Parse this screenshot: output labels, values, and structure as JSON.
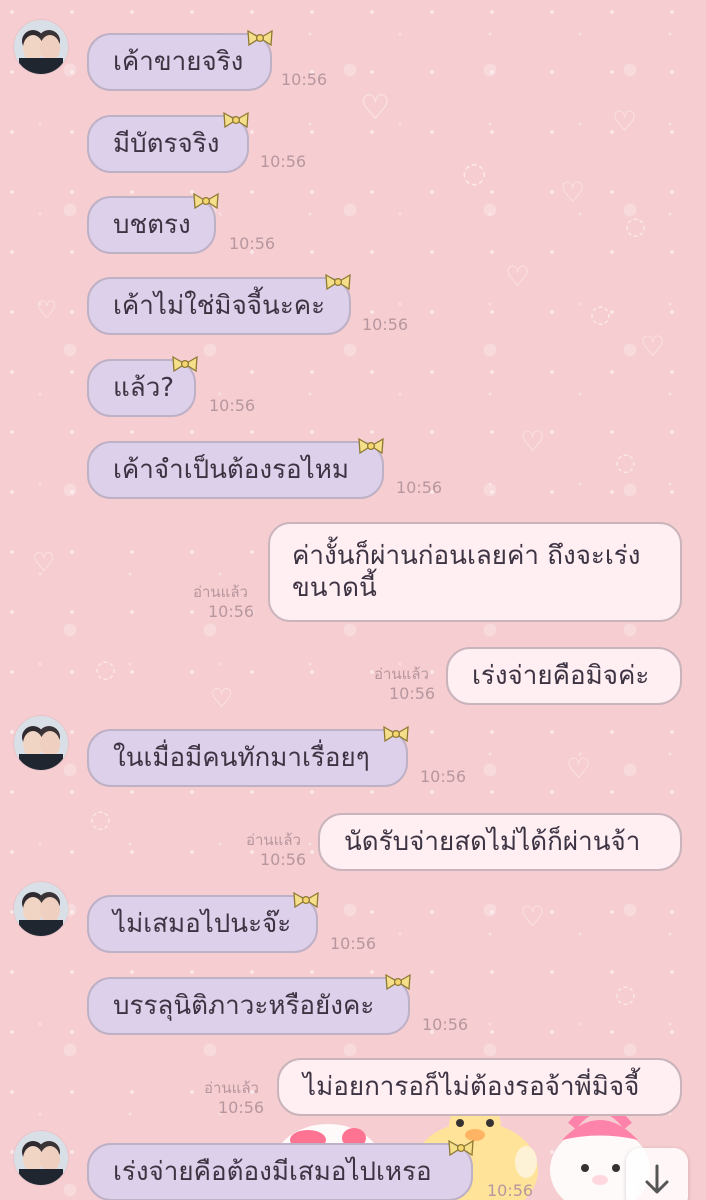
{
  "chat": {
    "incoming": [
      {
        "text": "เค้าขายจริง",
        "time": "10:56"
      },
      {
        "text": "มีบัตรจริง",
        "time": "10:56"
      },
      {
        "text": "บชตรง",
        "time": "10:56"
      },
      {
        "text": "เค้าไม่ใช่มิจจี้นะคะ",
        "time": "10:56"
      },
      {
        "text": "แล้ว?",
        "time": "10:56"
      },
      {
        "text": "เค้าจำเป็นต้องรอไหม",
        "time": "10:56"
      },
      {
        "text": "ในเมื่อมีคนทักมาเรื่อยๆ",
        "time": "10:56"
      },
      {
        "text": "ไม่เสมอไปนะจ๊ะ",
        "time": "10:56"
      },
      {
        "text": "บรรลุนิติภาวะหรือยังคะ",
        "time": "10:56"
      },
      {
        "text": "เร่งจ่ายคือต้องมีเสมอไปเหรอ",
        "time": "10:56"
      }
    ],
    "outgoing": [
      {
        "line1": "ค่างั้นก็ผ่านก่อนเลยค่า ถึงจะเร่ง",
        "line2": "ขนาดนี้",
        "read": "อ่านแล้ว",
        "time": "10:56"
      },
      {
        "text": "เร่งจ่ายคือมิจค่ะ",
        "read": "อ่านแล้ว",
        "time": "10:56"
      },
      {
        "text": "นัดรับจ่ายสดไม่ได้ก็ผ่านจ้า",
        "read": "อ่านแล้ว",
        "time": "10:56"
      },
      {
        "text": "ไม่อยการอก็ไม่ต้องรอจ้าพี่มิจจี้",
        "read": "อ่านแล้ว",
        "time": "10:56"
      }
    ]
  },
  "colors": {
    "background": "#f6cdd0",
    "incoming_bubble": "#ddd0ea",
    "outgoing_bubble": "#ffeef2",
    "timestamp": "#b7979f"
  },
  "icons": {
    "avatar": "avatar-photo",
    "bow": "bow-sticker-icon",
    "scroll_down": "arrow-down-icon"
  }
}
